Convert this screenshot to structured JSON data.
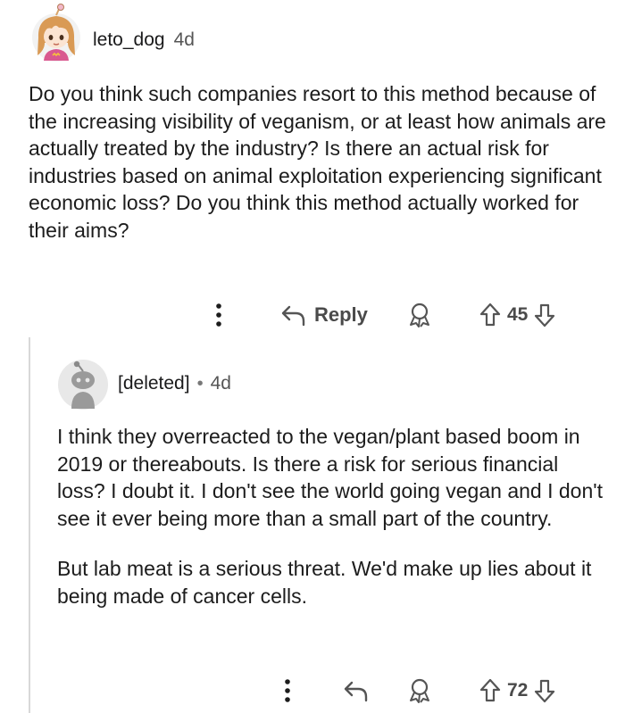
{
  "parent_comment": {
    "author": "leto_dog",
    "age": "4d",
    "body": "Do you think such companies resort to this method because of the increasing visibility of veganism, or at least how animals are actually treated by the industry? Is there an actual risk for industries based on animal exploitation experiencing significant economic loss? Do you think this method actually worked for their aims?",
    "reply_label": "Reply",
    "score": "45",
    "icons": [
      "more-options-icon",
      "reply-arrow-icon",
      "award-icon",
      "upvote-icon",
      "downvote-icon"
    ]
  },
  "reply_comment": {
    "author": "[deleted]",
    "separator": "•",
    "age": "4d",
    "paragraphs": [
      "I think they overreacted to the vegan/plant based boom in 2019 or thereabouts. Is there a risk for serious financial loss? I doubt it. I don't see the world going vegan and I don't see it ever being more than a small part of the country.",
      "But lab meat is a serious threat. We'd make up lies about it being made of cancer cells."
    ],
    "score": "72",
    "icons": [
      "more-options-icon",
      "reply-arrow-icon",
      "award-icon",
      "upvote-icon",
      "downvote-icon"
    ]
  },
  "colors": {
    "text": "#1c1c1c",
    "meta": "#555555",
    "thread_line": "#d8d8d8",
    "avatar_bg": "#e8e8e8"
  }
}
